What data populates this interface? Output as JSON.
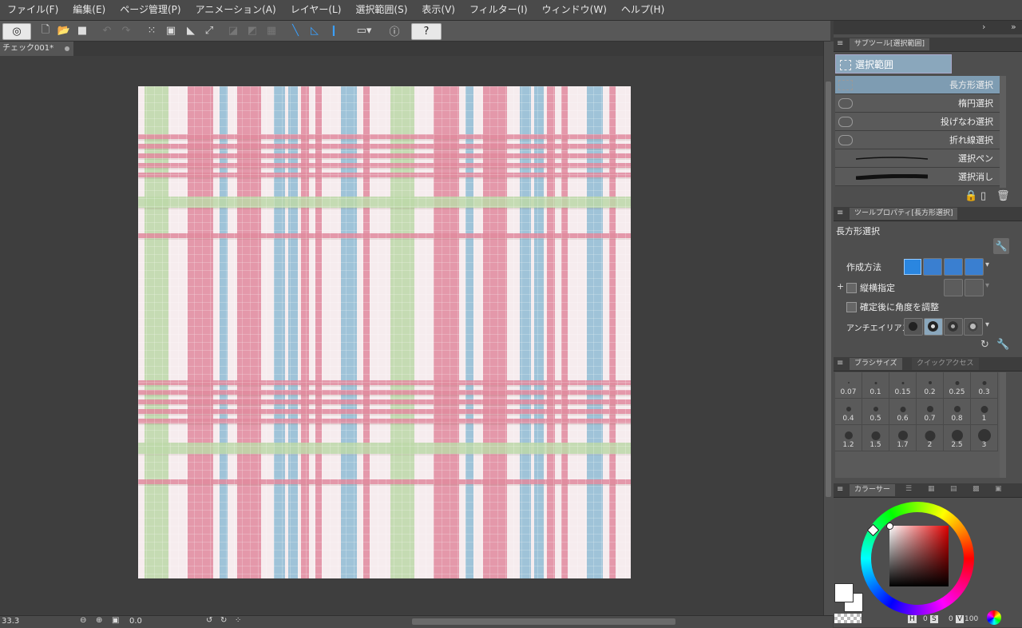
{
  "menu": [
    "ファイル(F)",
    "編集(E)",
    "ページ管理(P)",
    "アニメーション(A)",
    "レイヤー(L)",
    "選択範囲(S)",
    "表示(V)",
    "フィルター(I)",
    "ウィンドウ(W)",
    "ヘルプ(H)"
  ],
  "document": {
    "tab_title": "チェック001*"
  },
  "status": {
    "zoom": "33.3",
    "rotation": "0.0"
  },
  "subtool_panel": {
    "tab": "サブツール[選択範囲]",
    "group": "選択範囲",
    "items": [
      {
        "label": "長方形選択",
        "selected": true,
        "icon": "rect-select-icon"
      },
      {
        "label": "楕円選択",
        "selected": false,
        "icon": "ellipse-select-icon"
      },
      {
        "label": "投げなわ選択",
        "selected": false,
        "icon": "lasso-icon"
      },
      {
        "label": "折れ線選択",
        "selected": false,
        "icon": "polyline-icon"
      },
      {
        "label": "選択ペン",
        "selected": false,
        "icon": "select-pen-icon"
      },
      {
        "label": "選択消し",
        "selected": false,
        "icon": "select-eraser-icon"
      }
    ]
  },
  "tool_property": {
    "tab": "ツールプロパティ[長方形選択]",
    "tool_name": "長方形選択",
    "create_method_label": "作成方法",
    "aspect_label": "縦横指定",
    "adjust_angle_label": "確定後に角度を調整",
    "antialias_label": "アンチエイリアス"
  },
  "brush_size": {
    "tab": "ブラシサイズ",
    "tab2": "クイックアクセス",
    "sizes": [
      "0.07",
      "0.1",
      "0.15",
      "0.2",
      "0.25",
      "0.3",
      "0.4",
      "0.5",
      "0.6",
      "0.7",
      "0.8",
      "1",
      "1.2",
      "1.5",
      "1.7",
      "2",
      "2.5",
      "3"
    ]
  },
  "color_panel": {
    "tab": "カラーサー",
    "hsv": {
      "h_label": "H",
      "h": "0",
      "s_label": "S",
      "s": "0",
      "v_label": "V",
      "v": "100"
    },
    "main_color": "#ffffff"
  },
  "colors": {
    "pink": "#e08a9d",
    "blue": "#8fbcd3",
    "green": "#bcd8a8",
    "cream": "#f6ecee"
  }
}
